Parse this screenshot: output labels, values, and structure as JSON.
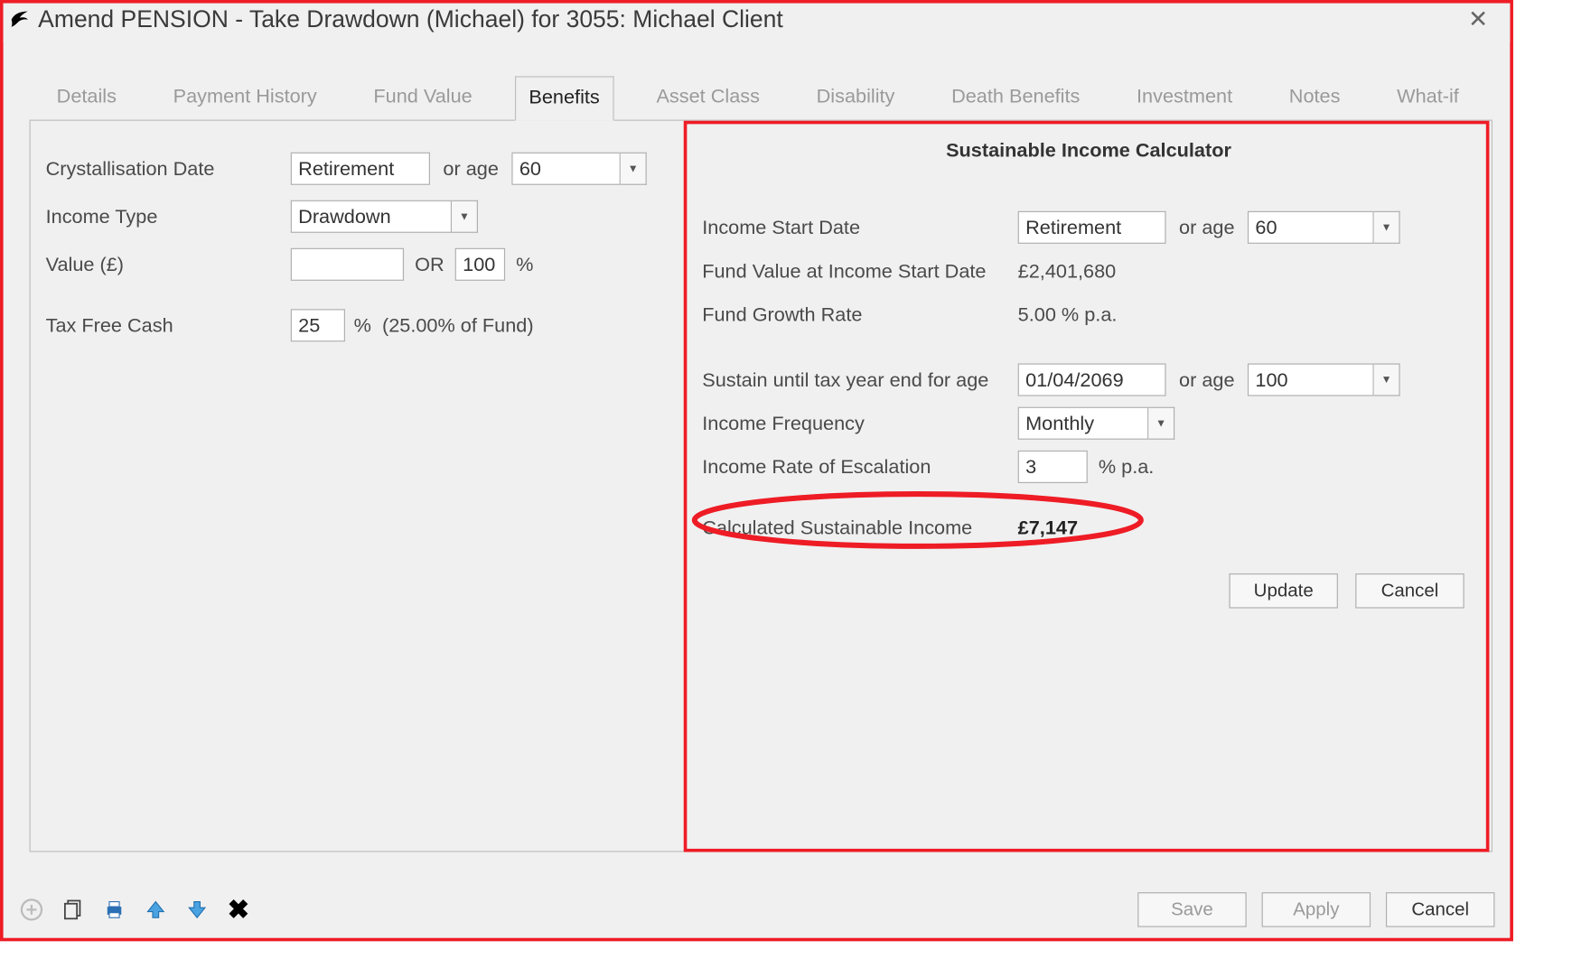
{
  "window": {
    "title": "Amend PENSION - Take Drawdown (Michael) for 3055: Michael Client"
  },
  "tabs": [
    "Details",
    "Payment History",
    "Fund Value",
    "Benefits",
    "Asset Class",
    "Disability",
    "Death Benefits",
    "Investment",
    "Notes",
    "What-if"
  ],
  "active_tab_index": 3,
  "form": {
    "cryst_label": "Crystallisation Date",
    "cryst_value": "Retirement",
    "or_age_label": "or age",
    "cryst_age": "60",
    "income_type_label": "Income Type",
    "income_type_value": "Drawdown",
    "value_label": "Value (£)",
    "value_amount": "",
    "or_label": "OR",
    "value_pct": "100",
    "pct_sign": "%",
    "tfc_label": "Tax Free Cash",
    "tfc_pct": "25",
    "tfc_note": "(25.00% of Fund)"
  },
  "calc": {
    "title": "Sustainable Income Calculator",
    "start_label": "Income Start Date",
    "start_value": "Retirement",
    "start_age": "60",
    "fundval_label": "Fund Value at Income Start Date",
    "fundval_value": "£2,401,680",
    "growth_label": "Fund Growth Rate",
    "growth_value": "5.00 % p.a.",
    "sustain_label": "Sustain until tax year end for age",
    "sustain_date": "01/04/2069",
    "sustain_age": "100",
    "freq_label": "Income Frequency",
    "freq_value": "Monthly",
    "esc_label": "Income Rate of Escalation",
    "esc_value": "3",
    "esc_suffix": "% p.a.",
    "result_label": "Calculated Sustainable Income",
    "result_value": "£7,147",
    "update": "Update",
    "cancel": "Cancel"
  },
  "bottom": {
    "save": "Save",
    "apply": "Apply",
    "cancel": "Cancel"
  }
}
